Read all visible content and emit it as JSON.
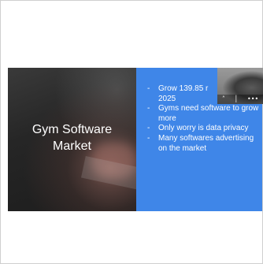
{
  "slide": {
    "title": "Gym Software\nMarket",
    "bullets": [
      "Grow 139.85 r\n2025",
      "Gyms need software to grow more",
      "Only worry is data privacy",
      "Many softwares advertising on the market"
    ],
    "bullet_marker": "-",
    "accent_color": "#3f86e8"
  },
  "video_overlay": {
    "icons": [
      "chevron-up-icon",
      "mic-icon",
      "more-icon"
    ],
    "glyphs": [
      "˄",
      "│",
      "•••"
    ]
  }
}
